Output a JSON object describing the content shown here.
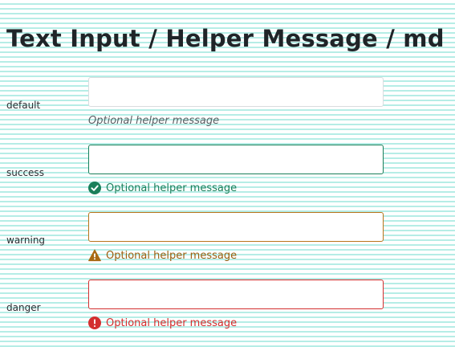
{
  "title": "Text Input / Helper Message / md",
  "colors": {
    "success": "#1a7f5a",
    "warning": "#b8741a",
    "danger": "#d32f2f",
    "default_border": "#d9dcdf",
    "grid_lines": "#b6ede6"
  },
  "rows": [
    {
      "state": "default",
      "label": "default",
      "value": "",
      "helper": "Optional helper message",
      "icon": null
    },
    {
      "state": "success",
      "label": "success",
      "value": "",
      "helper": "Optional helper message",
      "icon": "check-circle-icon"
    },
    {
      "state": "warning",
      "label": "warning",
      "value": "",
      "helper": "Optional helper message",
      "icon": "warning-triangle-icon"
    },
    {
      "state": "danger",
      "label": "danger",
      "value": "",
      "helper": "Optional helper message",
      "icon": "exclamation-circle-icon"
    }
  ]
}
